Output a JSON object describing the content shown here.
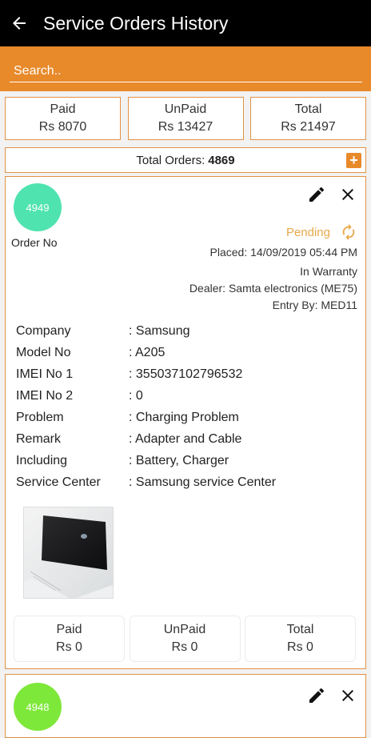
{
  "header": {
    "title": "Service Orders History"
  },
  "search": {
    "placeholder": "Search.."
  },
  "summary": {
    "paid_label": "Paid",
    "paid_value": "Rs 8070",
    "unpaid_label": "UnPaid",
    "unpaid_value": "Rs 13427",
    "total_label": "Total",
    "total_value": "Rs 21497"
  },
  "total_orders": {
    "label": "Total Orders:",
    "value": "4869"
  },
  "orders": [
    {
      "number": "4949",
      "badge_color": "#4fe3b0",
      "order_no_label": "Order No",
      "status": "Pending",
      "placed": "Placed: 14/09/2019 05:44 PM",
      "warranty": "In Warranty",
      "dealer": "Dealer: Samta electronics (ME75)",
      "entry_by": "Entry By: MED11",
      "details": [
        {
          "label": "Company",
          "value": ": Samsung"
        },
        {
          "label": "Model No",
          "value": ": A205"
        },
        {
          "label": "IMEI No 1",
          "value": ": 355037102796532"
        },
        {
          "label": "IMEI No 2",
          "value": ": 0"
        },
        {
          "label": "Problem",
          "value": ": Charging Problem"
        },
        {
          "label": "Remark",
          "value": ": Adapter and Cable"
        },
        {
          "label": "Including",
          "value": ": Battery, Charger"
        },
        {
          "label": "Service Center",
          "value": ": Samsung service Center"
        }
      ],
      "paid_label": "Paid",
      "paid_value": "Rs 0",
      "unpaid_label": "UnPaid",
      "unpaid_value": "Rs 0",
      "total_label": "Total",
      "total_value": "Rs 0"
    },
    {
      "number": "4948",
      "badge_color": "#7ee83a"
    }
  ],
  "colors": {
    "accent": "#e8892a",
    "appbar": "#000000",
    "pending": "#e8a84a"
  }
}
